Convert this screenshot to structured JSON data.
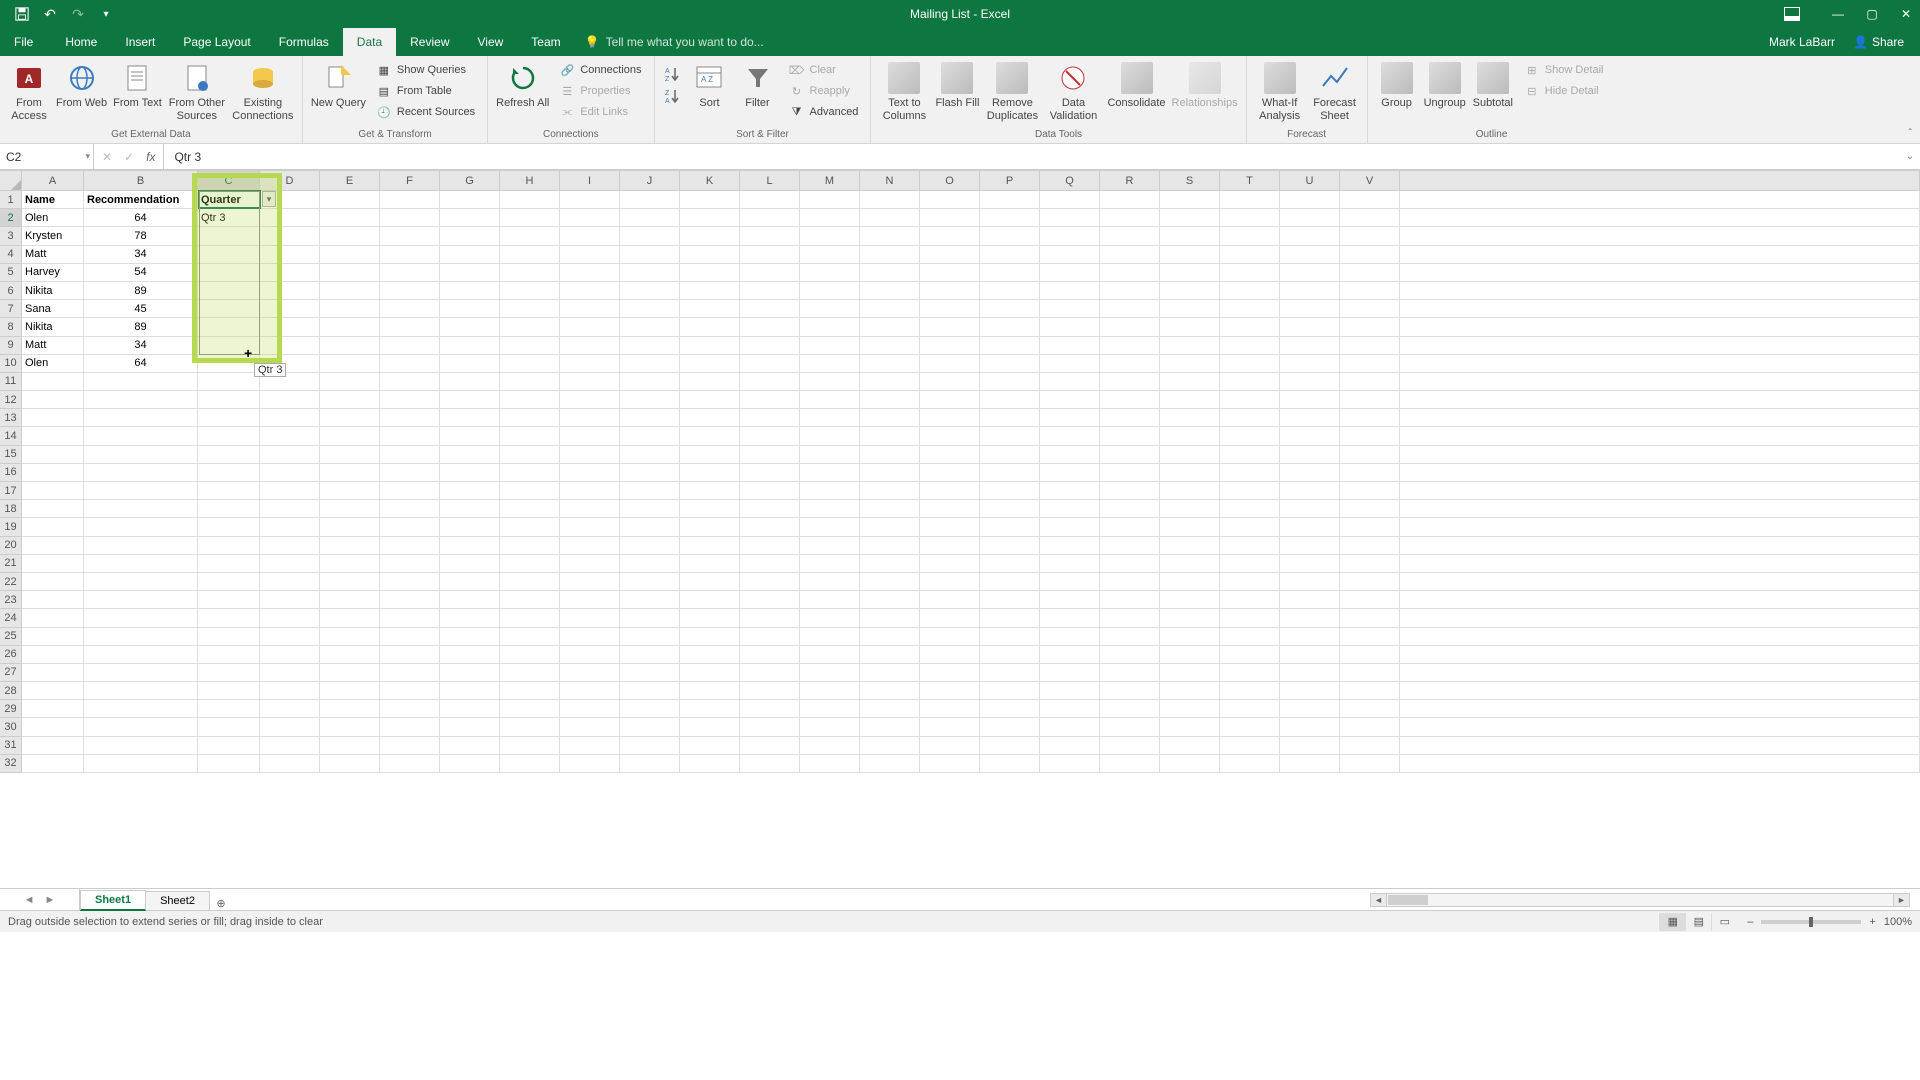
{
  "title": "Mailing List - Excel",
  "user": "Mark LaBarr",
  "share": "Share",
  "tabs": [
    "File",
    "Home",
    "Insert",
    "Page Layout",
    "Formulas",
    "Data",
    "Review",
    "View",
    "Team"
  ],
  "active_tab": "Data",
  "tell_me": "Tell me what you want to do...",
  "namebox": "C2",
  "formula": "Qtr 3",
  "ribbon": {
    "g1": {
      "label": "Get External Data",
      "btns": [
        "From Access",
        "From Web",
        "From Text",
        "From Other Sources",
        "Existing Connections"
      ]
    },
    "g2": {
      "label": "Get & Transform",
      "big": "New Query",
      "minis": [
        "Show Queries",
        "From Table",
        "Recent Sources"
      ]
    },
    "g3": {
      "label": "Connections",
      "big": "Refresh All",
      "minis": [
        "Connections",
        "Properties",
        "Edit Links"
      ]
    },
    "g4": {
      "label": "Sort & Filter",
      "sort": "Sort",
      "filter": "Filter",
      "minis": [
        "Clear",
        "Reapply",
        "Advanced"
      ]
    },
    "g5": {
      "label": "Data Tools",
      "btns": [
        "Text to Columns",
        "Flash Fill",
        "Remove Duplicates",
        "Data Validation",
        "Consolidate",
        "Relationships"
      ]
    },
    "g6": {
      "label": "Forecast",
      "btns": [
        "What-If Analysis",
        "Forecast Sheet"
      ]
    },
    "g7": {
      "label": "Outline",
      "btns": [
        "Group",
        "Ungroup",
        "Subtotal"
      ],
      "minis": [
        "Show Detail",
        "Hide Detail"
      ]
    }
  },
  "columns": [
    "A",
    "B",
    "C",
    "D",
    "E",
    "F",
    "G",
    "H",
    "I",
    "J",
    "K",
    "L",
    "M",
    "N",
    "O",
    "P",
    "Q",
    "R",
    "S",
    "T",
    "U",
    "V"
  ],
  "col_widths": {
    "A": 62,
    "B": 114,
    "C": 62,
    "default": 60
  },
  "headers": {
    "A": "Name",
    "B": "Recommendation",
    "C": "Quarter"
  },
  "c2_value": "Qtr 3",
  "table": [
    {
      "name": "Olen",
      "rec": 64
    },
    {
      "name": "Krysten",
      "rec": 78
    },
    {
      "name": "Matt",
      "rec": 34
    },
    {
      "name": "Harvey",
      "rec": 54
    },
    {
      "name": "Nikita",
      "rec": 89
    },
    {
      "name": "Sana",
      "rec": 45
    },
    {
      "name": "Nikita",
      "rec": 89
    },
    {
      "name": "Matt",
      "rec": 34
    },
    {
      "name": "Olen",
      "rec": 64
    }
  ],
  "drag_tooltip": "Qtr 3",
  "sheets": [
    "Sheet1",
    "Sheet2"
  ],
  "active_sheet": "Sheet1",
  "status_text": "Drag outside selection to extend series or fill; drag inside to clear",
  "zoom": "100%"
}
